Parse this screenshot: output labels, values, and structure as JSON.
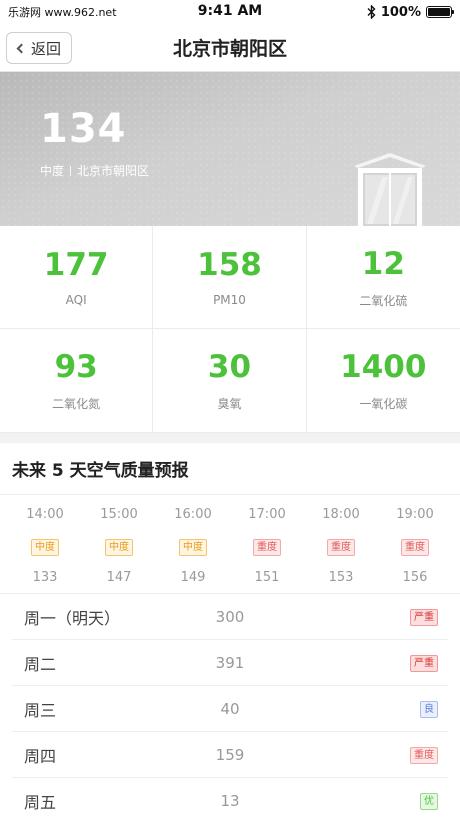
{
  "status_bar": {
    "left_text": "乐游网 www.962.net",
    "time": "9:41 AM",
    "battery": "100%",
    "battery_level": 1.0
  },
  "nav": {
    "back_label": "返回",
    "title": "北京市朝阳区"
  },
  "hero": {
    "aqi": "134",
    "level": "中度",
    "location": "北京市朝阳区"
  },
  "metrics": [
    {
      "value": "177",
      "label": "AQI"
    },
    {
      "value": "158",
      "label": "PM10"
    },
    {
      "value": "12",
      "label": "二氧化硫"
    },
    {
      "value": "93",
      "label": "二氧化氮"
    },
    {
      "value": "30",
      "label": "臭氧"
    },
    {
      "value": "1400",
      "label": "一氧化碳"
    }
  ],
  "colors": {
    "metric_green": "#4cc23a",
    "moderate": "#e99a1b",
    "heavy": "#e45a5a",
    "good": "#5b7fd9"
  },
  "forecast": {
    "title": "未来 5 天空气质量预报",
    "hourly": [
      {
        "time": "14:00",
        "level": "中度",
        "aqi": "133"
      },
      {
        "time": "15:00",
        "level": "中度",
        "aqi": "147"
      },
      {
        "time": "16:00",
        "level": "中度",
        "aqi": "149"
      },
      {
        "time": "17:00",
        "level": "重度",
        "aqi": "151"
      },
      {
        "time": "18:00",
        "level": "重度",
        "aqi": "153"
      },
      {
        "time": "19:00",
        "level": "重度",
        "aqi": "156"
      }
    ],
    "daily": [
      {
        "day": "周一（明天）",
        "aqi": "300",
        "level": "严重"
      },
      {
        "day": "周二",
        "aqi": "391",
        "level": "严重"
      },
      {
        "day": "周三",
        "aqi": "40",
        "level": "良"
      },
      {
        "day": "周四",
        "aqi": "159",
        "level": "重度"
      },
      {
        "day": "周五",
        "aqi": "13",
        "level": "优"
      }
    ]
  }
}
